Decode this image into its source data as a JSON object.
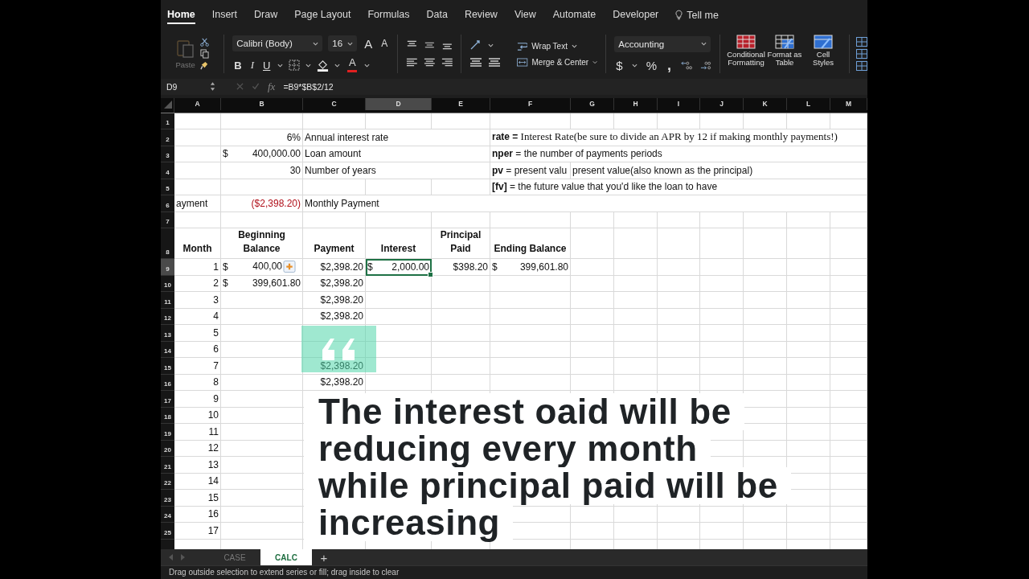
{
  "menu_tabs": [
    {
      "label": "Home",
      "selected": true
    },
    {
      "label": "Insert",
      "selected": false
    },
    {
      "label": "Draw",
      "selected": false
    },
    {
      "label": "Page Layout",
      "selected": false
    },
    {
      "label": "Formulas",
      "selected": false
    },
    {
      "label": "Data",
      "selected": false
    },
    {
      "label": "Review",
      "selected": false
    },
    {
      "label": "View",
      "selected": false
    },
    {
      "label": "Automate",
      "selected": false
    },
    {
      "label": "Developer",
      "selected": false
    }
  ],
  "tell_me": "Tell me",
  "ribbon": {
    "paste": {
      "label": "Paste",
      "disabled": true
    },
    "font": {
      "name": "Calibri (Body)",
      "size": "16",
      "grow": "A",
      "shrink": "A",
      "bold": "B",
      "italic": "I",
      "underline": "U",
      "font_color": "A"
    },
    "wrap_text": "Wrap Text",
    "merge": "Merge & Center",
    "number_format": "Accounting",
    "currency": "$",
    "percent": "%",
    "comma": ",",
    "styles": [
      {
        "label": "Conditional Formatting",
        "kind": "conditional"
      },
      {
        "label": "Format as Table",
        "kind": "table"
      },
      {
        "label": "Cell Styles",
        "kind": "styles"
      }
    ]
  },
  "formula_bar": {
    "name_box": "D9",
    "function_label": "fx",
    "formula": "=B9*$B$2/12"
  },
  "columns": [
    {
      "label": "A",
      "selected": false
    },
    {
      "label": "B",
      "selected": false
    },
    {
      "label": "C",
      "selected": false
    },
    {
      "label": "D",
      "selected": true
    },
    {
      "label": "E",
      "selected": false
    },
    {
      "label": "F",
      "selected": false
    },
    {
      "label": "G",
      "selected": false
    },
    {
      "label": "H",
      "selected": false
    },
    {
      "label": "I",
      "selected": false
    },
    {
      "label": "J",
      "selected": false
    },
    {
      "label": "K",
      "selected": false
    },
    {
      "label": "L",
      "selected": false
    },
    {
      "label": "M",
      "selected": false
    }
  ],
  "rows": [
    {
      "number": "1",
      "selected": false,
      "cells": {}
    },
    {
      "number": "2",
      "selected": false,
      "cells": {
        "B": {
          "kind": "number",
          "text": "6%"
        },
        "C": {
          "kind": "text",
          "text": "Annual interest rate"
        },
        "F": {
          "kind": "serif-note",
          "text": "**rate =** Interest Rate(be sure to divide an APR by 12 if making monthly payments!)"
        }
      }
    },
    {
      "number": "3",
      "selected": false,
      "cells": {
        "B": {
          "kind": "accounting",
          "symbol": "$",
          "text": "400,000.00"
        },
        "C": {
          "kind": "text",
          "text": "Loan amount"
        },
        "F": {
          "kind": "note",
          "text": "**nper** = the number of payments periods"
        }
      }
    },
    {
      "number": "4",
      "selected": false,
      "cells": {
        "B": {
          "kind": "number",
          "text": "30"
        },
        "C": {
          "kind": "text",
          "text": "Number of years"
        },
        "F": {
          "kind": "note",
          "text": "**pv** = present valu"
        },
        "G": {
          "kind": "text",
          "text": "present value(also known as the principal)"
        }
      }
    },
    {
      "number": "5",
      "selected": false,
      "cells": {
        "F": {
          "kind": "note",
          "text": "**[fv]** = the future value that you'd like the loan to have"
        }
      }
    },
    {
      "number": "6",
      "selected": false,
      "cells": {
        "A": {
          "kind": "text",
          "text": "ayment"
        },
        "B": {
          "kind": "negative",
          "text": "($2,398.20)"
        },
        "C": {
          "kind": "text",
          "text": "Monthly Payment"
        }
      }
    },
    {
      "number": "7",
      "selected": false,
      "cells": {}
    },
    {
      "number": "8",
      "selected": false,
      "cells": {
        "A": {
          "kind": "header",
          "text": "Month"
        },
        "B": {
          "kind": "header",
          "text": "Beginning Balance"
        },
        "C": {
          "kind": "header",
          "text": "Payment"
        },
        "D": {
          "kind": "header",
          "text": "Interest"
        },
        "E": {
          "kind": "header",
          "text": "Principal Paid"
        },
        "F": {
          "kind": "header",
          "text": "Ending Balance"
        }
      }
    },
    {
      "number": "9",
      "selected": true,
      "cells": {
        "A": {
          "kind": "number",
          "text": "1"
        },
        "B": {
          "kind": "accounting",
          "symbol": "$",
          "text": "400,00",
          "paste_options": true
        },
        "C": {
          "kind": "number",
          "text": "$2,398.20"
        },
        "D": {
          "kind": "accounting",
          "symbol": "$",
          "text": "2,000.00",
          "selected": true
        },
        "E": {
          "kind": "number",
          "text": "$398.20"
        },
        "F": {
          "kind": "accounting",
          "symbol": "$",
          "text": "399,601.80"
        }
      }
    },
    {
      "number": "10",
      "selected": false,
      "cells": {
        "A": {
          "kind": "number",
          "text": "2"
        },
        "B": {
          "kind": "accounting",
          "symbol": "$",
          "text": "399,601.80"
        },
        "C": {
          "kind": "number",
          "text": "$2,398.20"
        }
      }
    },
    {
      "number": "11",
      "selected": false,
      "cells": {
        "A": {
          "kind": "number",
          "text": "3"
        },
        "C": {
          "kind": "number",
          "text": "$2,398.20"
        }
      }
    },
    {
      "number": "12",
      "selected": false,
      "cells": {
        "A": {
          "kind": "number",
          "text": "4"
        },
        "C": {
          "kind": "number",
          "text": "$2,398.20"
        }
      }
    },
    {
      "number": "13",
      "selected": false,
      "cells": {
        "A": {
          "kind": "number",
          "text": "5"
        }
      }
    },
    {
      "number": "14",
      "selected": false,
      "cells": {
        "A": {
          "kind": "number",
          "text": "6"
        }
      }
    },
    {
      "number": "15",
      "selected": false,
      "cells": {
        "A": {
          "kind": "number",
          "text": "7"
        },
        "C": {
          "kind": "number",
          "text": "$2,398.20"
        }
      }
    },
    {
      "number": "16",
      "selected": false,
      "cells": {
        "A": {
          "kind": "number",
          "text": "8"
        },
        "C": {
          "kind": "number",
          "text": "$2,398.20"
        }
      }
    },
    {
      "number": "17",
      "selected": false,
      "cells": {
        "A": {
          "kind": "number",
          "text": "9"
        }
      }
    },
    {
      "number": "18",
      "selected": false,
      "cells": {
        "A": {
          "kind": "number",
          "text": "10"
        }
      }
    },
    {
      "number": "19",
      "selected": false,
      "cells": {
        "A": {
          "kind": "number",
          "text": "11"
        }
      }
    },
    {
      "number": "20",
      "selected": false,
      "cells": {
        "A": {
          "kind": "number",
          "text": "12"
        }
      }
    },
    {
      "number": "21",
      "selected": false,
      "cells": {
        "A": {
          "kind": "number",
          "text": "13"
        }
      }
    },
    {
      "number": "22",
      "selected": false,
      "cells": {
        "A": {
          "kind": "number",
          "text": "14"
        }
      }
    },
    {
      "number": "23",
      "selected": false,
      "cells": {
        "A": {
          "kind": "number",
          "text": "15"
        }
      }
    },
    {
      "number": "24",
      "selected": false,
      "cells": {
        "A": {
          "kind": "number",
          "text": "16"
        }
      }
    },
    {
      "number": "25",
      "selected": false,
      "cells": {
        "A": {
          "kind": "number",
          "text": "17"
        }
      }
    }
  ],
  "sheet_tabs": [
    {
      "label": "CASE",
      "selected": false
    },
    {
      "label": "CALC",
      "selected": true
    }
  ],
  "add_sheet": "+",
  "status_bar": "Drag outside selection to extend series or fill; drag inside to clear",
  "caption": {
    "lines": [
      "The interest oaid will be",
      "reducing every month",
      "while principal paid will be",
      "increasing"
    ]
  }
}
